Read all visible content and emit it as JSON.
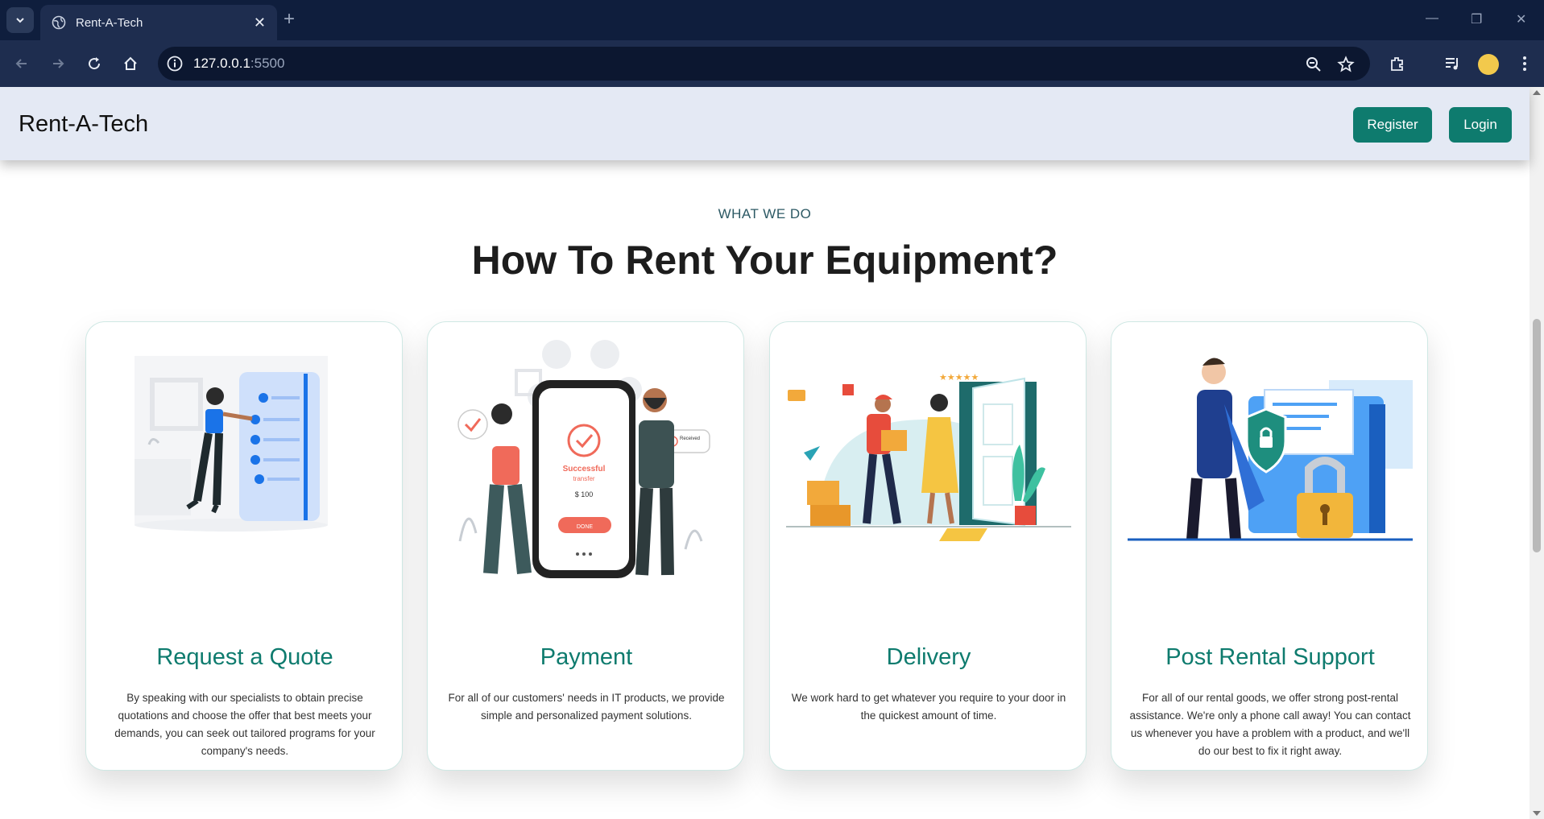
{
  "browser": {
    "tab_title": "Rent-A-Tech",
    "url_host": "127.0.0.1",
    "url_port": ":5500"
  },
  "site": {
    "brand": "Rent-A-Tech",
    "register_label": "Register",
    "login_label": "Login",
    "accent_color": "#0e7b6e"
  },
  "section": {
    "eyebrow": "WHAT WE DO",
    "headline": "How To Rent Your Equipment?"
  },
  "cards": [
    {
      "title": "Request a Quote",
      "text": "By speaking with our specialists to obtain precise quotations and choose the offer that best meets your demands, you can seek out tailored programs for your company's needs."
    },
    {
      "title": "Payment",
      "text": "For all of our customers' needs in IT products, we provide simple and personalized payment solutions.",
      "illustration": {
        "phone_status": "Successful",
        "phone_substatus": "transfer",
        "amount": "$ 100",
        "done_label": "DONE",
        "received_label": "Received"
      }
    },
    {
      "title": "Delivery",
      "text": "We work hard to get whatever you require to your door in the quickest amount of time."
    },
    {
      "title": "Post Rental Support",
      "text": "For all of our rental goods, we offer strong post-rental assistance. We're only a phone call away! You can contact us whenever you have a problem with a product, and we'll do our best to fix it right away."
    }
  ]
}
